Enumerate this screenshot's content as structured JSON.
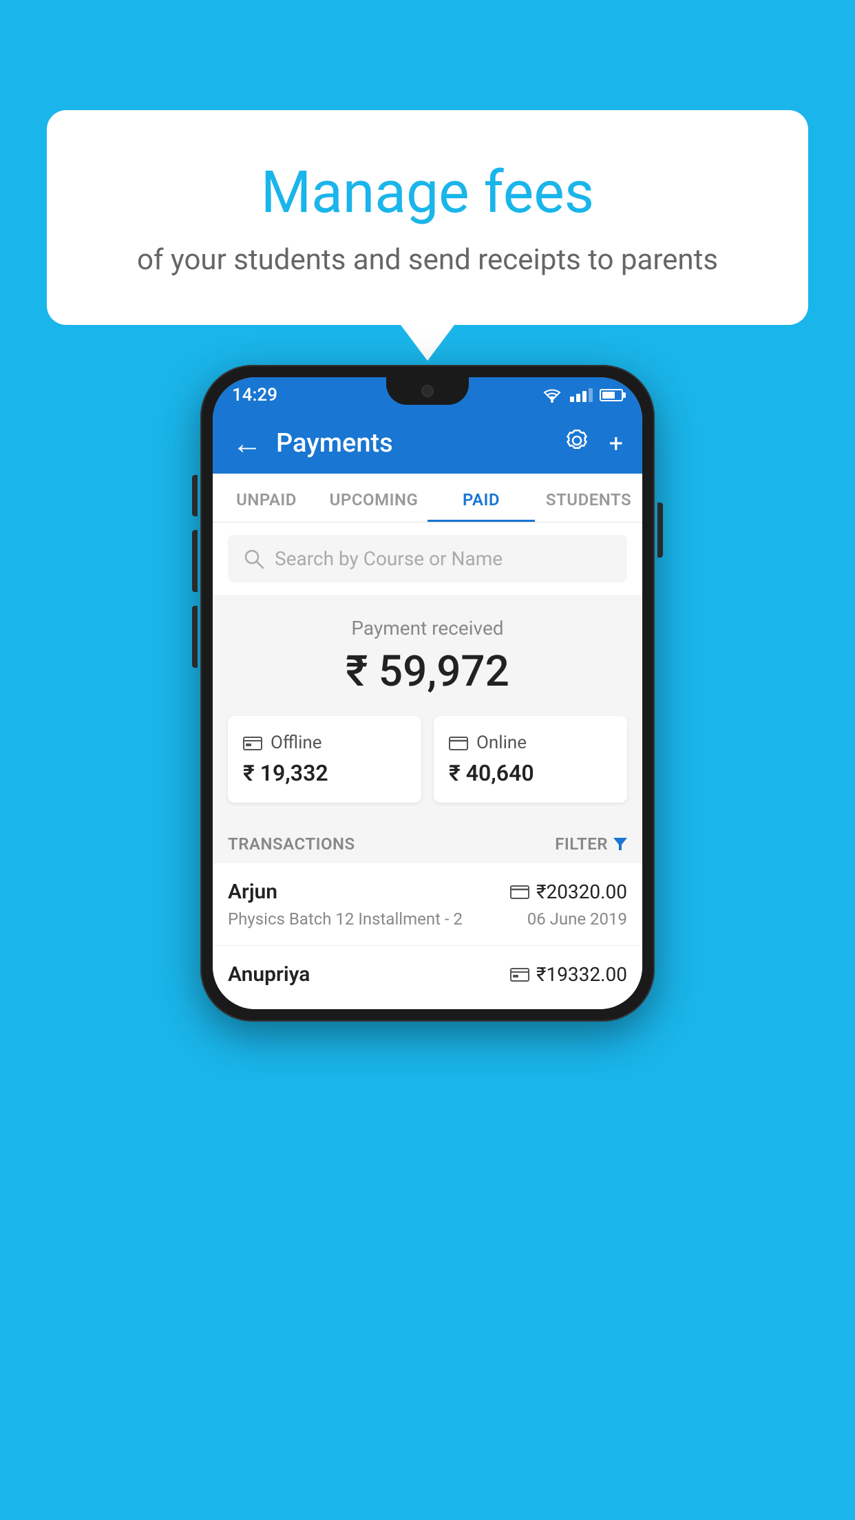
{
  "background_color": "#1ab5ea",
  "speech_bubble": {
    "title": "Manage fees",
    "subtitle": "of your students and send receipts to parents"
  },
  "status_bar": {
    "time": "14:29"
  },
  "app_header": {
    "title": "Payments",
    "back_icon": "←",
    "settings_icon": "⚙",
    "add_icon": "+"
  },
  "tabs": [
    {
      "label": "UNPAID",
      "active": false
    },
    {
      "label": "UPCOMING",
      "active": false
    },
    {
      "label": "PAID",
      "active": true
    },
    {
      "label": "STUDENTS",
      "active": false
    }
  ],
  "search": {
    "placeholder": "Search by Course or Name"
  },
  "payment_summary": {
    "label": "Payment received",
    "amount": "₹ 59,972"
  },
  "payment_cards": [
    {
      "icon": "offline",
      "label": "Offline",
      "amount": "₹ 19,332"
    },
    {
      "icon": "online",
      "label": "Online",
      "amount": "₹ 40,640"
    }
  ],
  "transactions_header": {
    "label": "TRANSACTIONS",
    "filter_label": "FILTER"
  },
  "transactions": [
    {
      "name": "Arjun",
      "course": "Physics Batch 12 Installment - 2",
      "amount": "₹20320.00",
      "date": "06 June 2019",
      "payment_type": "online"
    },
    {
      "name": "Anupriya",
      "course": "",
      "amount": "₹19332.00",
      "date": "",
      "payment_type": "offline"
    }
  ]
}
